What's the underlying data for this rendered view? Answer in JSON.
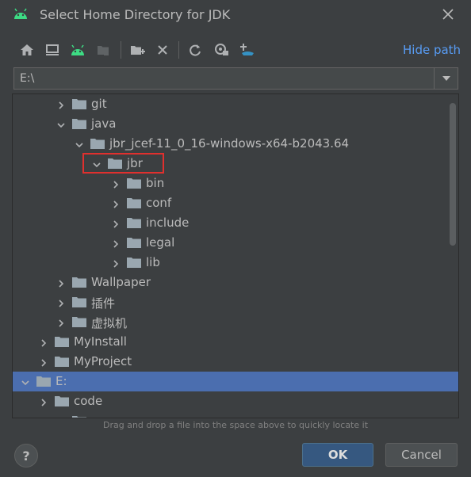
{
  "window": {
    "title": "Select Home Directory for JDK"
  },
  "toolbar": {
    "buttons": [
      "home-icon",
      "desktop-icon",
      "android-icon",
      "project-icon",
      "new-folder-icon",
      "delete-icon",
      "refresh-icon",
      "show-hidden-icon",
      "link-icon"
    ],
    "hide_path_label": "Hide path"
  },
  "path": {
    "value": "E:\\"
  },
  "tree": {
    "rows": [
      {
        "label": "git",
        "expanded": false
      },
      {
        "label": "java",
        "expanded": true
      },
      {
        "label": "jbr_jcef-11_0_16-windows-x64-b2043.64",
        "expanded": true
      },
      {
        "label": "jbr",
        "expanded": true
      },
      {
        "label": "bin",
        "expanded": false
      },
      {
        "label": "conf",
        "expanded": false
      },
      {
        "label": "include",
        "expanded": false
      },
      {
        "label": "legal",
        "expanded": false
      },
      {
        "label": "lib",
        "expanded": false
      },
      {
        "label": "Wallpaper",
        "expanded": false
      },
      {
        "label": "插件",
        "expanded": false
      },
      {
        "label": "虚拟机",
        "expanded": false
      },
      {
        "label": "MyInstall",
        "expanded": false
      },
      {
        "label": "MyProject",
        "expanded": false
      },
      {
        "label": "E:",
        "expanded": true
      },
      {
        "label": "code",
        "expanded": false
      },
      {
        "label": "",
        "expanded": false
      }
    ]
  },
  "hint": "Drag and drop a file into the space above to quickly locate it",
  "buttons": {
    "help": "?",
    "ok": "OK",
    "cancel": "Cancel"
  },
  "colors": {
    "background": "#3c3f41",
    "selection": "#4b6eaf",
    "accent_link": "#589df6",
    "android_green": "#3ddc84",
    "highlight_box": "#e0302e"
  }
}
